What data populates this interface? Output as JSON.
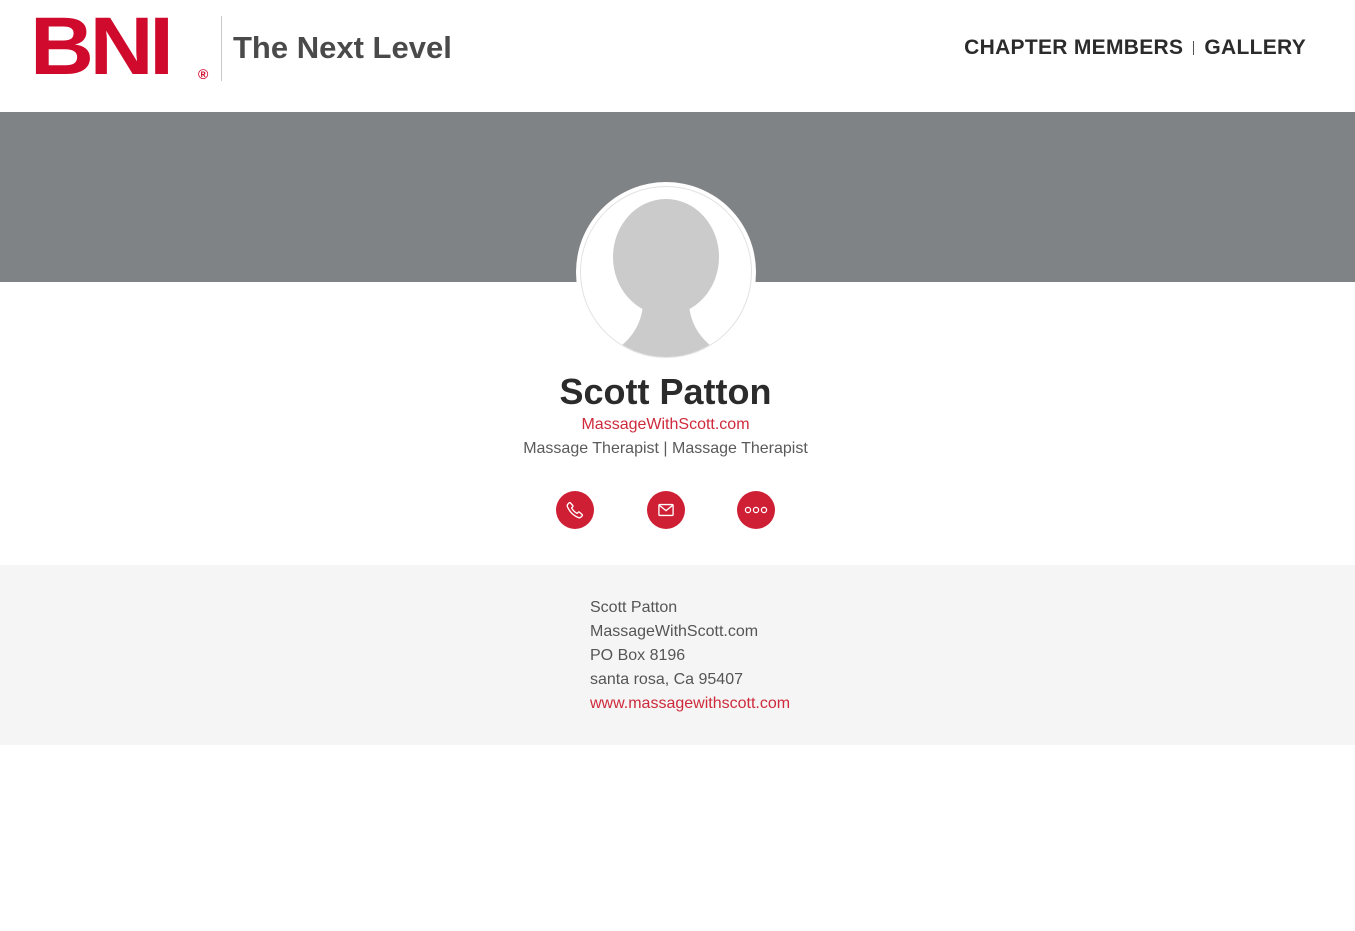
{
  "header": {
    "logo_text": "BNI",
    "logo_registered": "®",
    "chapter_name": "The Next Level",
    "nav": {
      "chapter_members": "CHAPTER MEMBERS",
      "gallery": "GALLERY"
    }
  },
  "profile": {
    "name": "Scott Patton",
    "company": "MassageWithScott.com",
    "profession": "Massage Therapist | Massage Therapist",
    "actions": [
      {
        "name": "phone-icon",
        "label": "Phone"
      },
      {
        "name": "email-icon",
        "label": "Email"
      },
      {
        "name": "more-icon",
        "label": "More"
      }
    ]
  },
  "address": {
    "name": "Scott Patton",
    "company": "MassageWithScott.com",
    "line1": "PO Box 8196",
    "city_state_zip": "santa rosa, Ca 95407",
    "website": "www.massagewithscott.com"
  },
  "colors": {
    "brand_red": "#cf0a2c",
    "banner_gray": "#808386",
    "address_bg": "#f4f5f4"
  }
}
